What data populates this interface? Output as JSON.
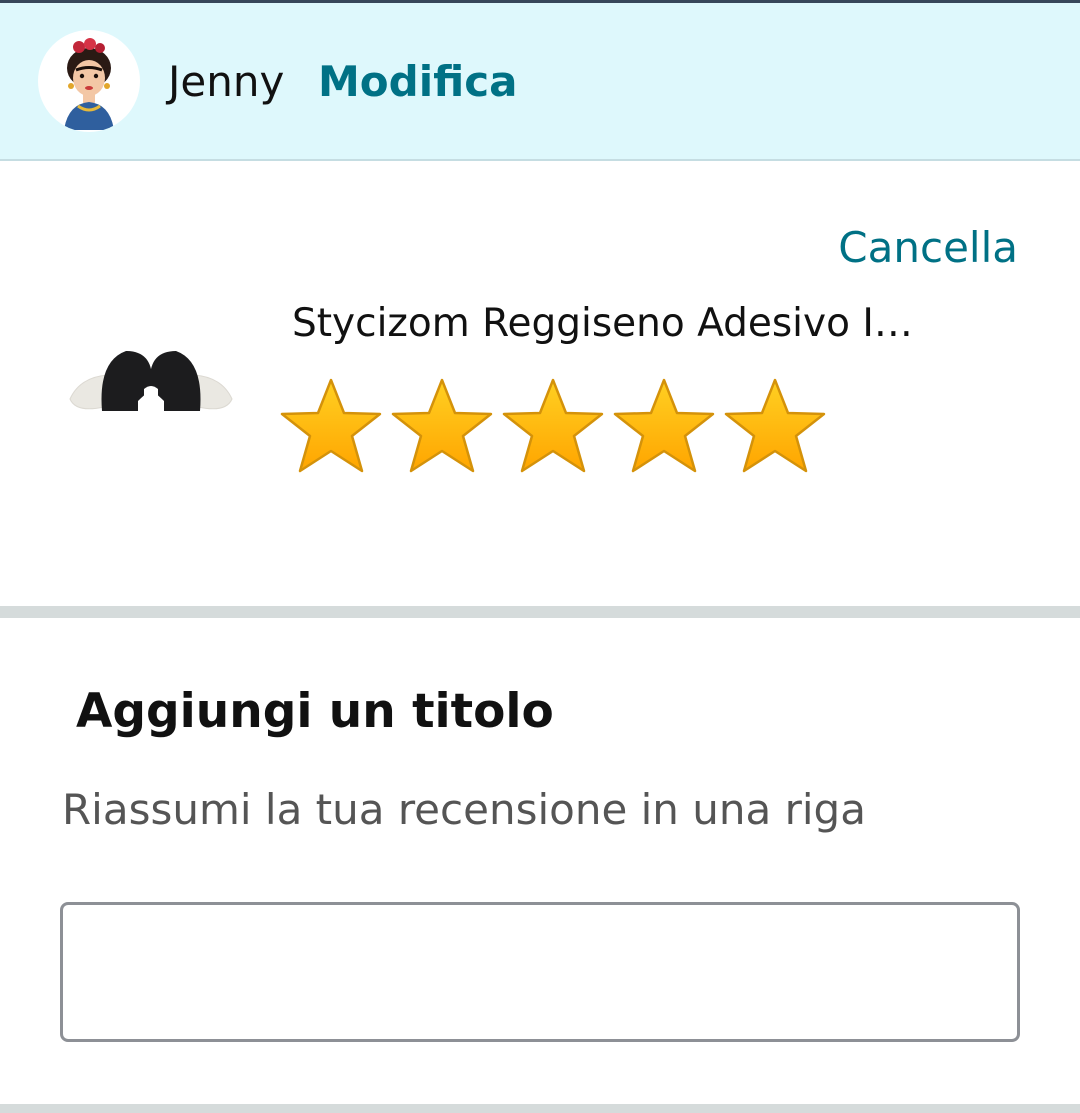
{
  "header": {
    "username": "Jenny",
    "edit_label": "Modifica"
  },
  "product": {
    "cancel_label": "Cancella",
    "title": "Stycizom Reggiseno Adesivo I…",
    "rating": 5,
    "max_rating": 5
  },
  "title_section": {
    "heading": "Aggiungi un titolo",
    "subtitle": "Riassumi la tua recensione in una riga",
    "input_value": ""
  },
  "colors": {
    "header_bg": "#def8fc",
    "link": "#007185",
    "star_fill": "#ffb700",
    "star_stroke": "#d4920a",
    "divider": "#d5dbdb"
  }
}
